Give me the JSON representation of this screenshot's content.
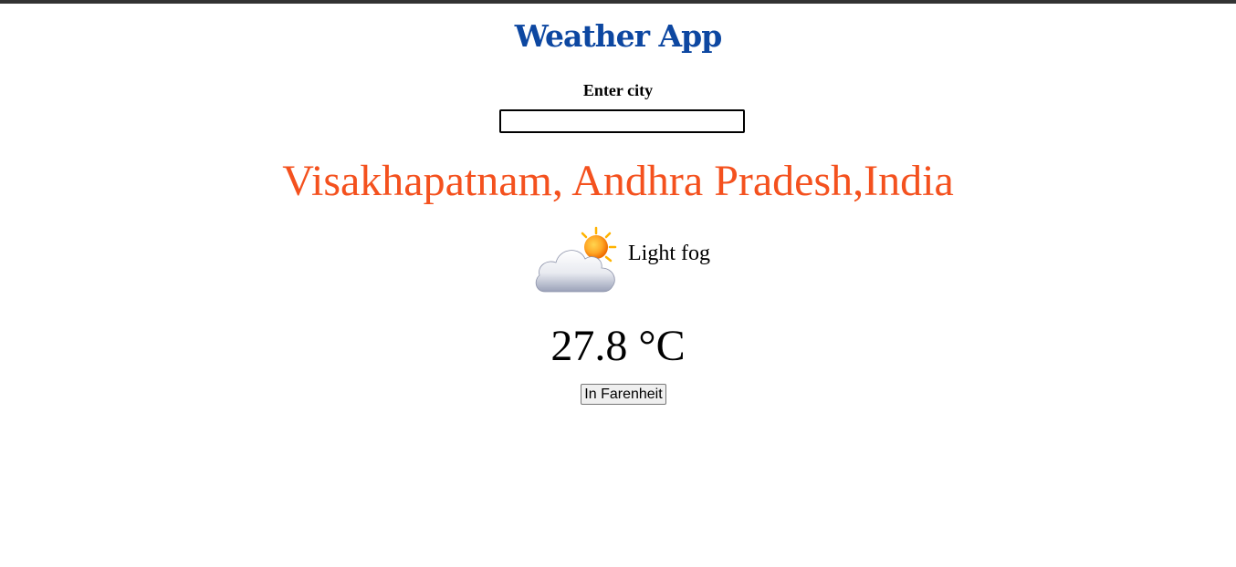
{
  "app": {
    "title": "Weather App"
  },
  "search": {
    "label": "Enter city",
    "value": "",
    "placeholder": ""
  },
  "weather": {
    "location": "Visakhapatnam, Andhra Pradesh,India",
    "condition": "Light fog",
    "condition_icon": "partly-cloudy-icon",
    "temperature": "27.8 °C"
  },
  "controls": {
    "unit_toggle_label": "In Farenheit"
  },
  "colors": {
    "title": "#0d47a1",
    "location": "#f4511e",
    "top_bar": "#333333"
  }
}
